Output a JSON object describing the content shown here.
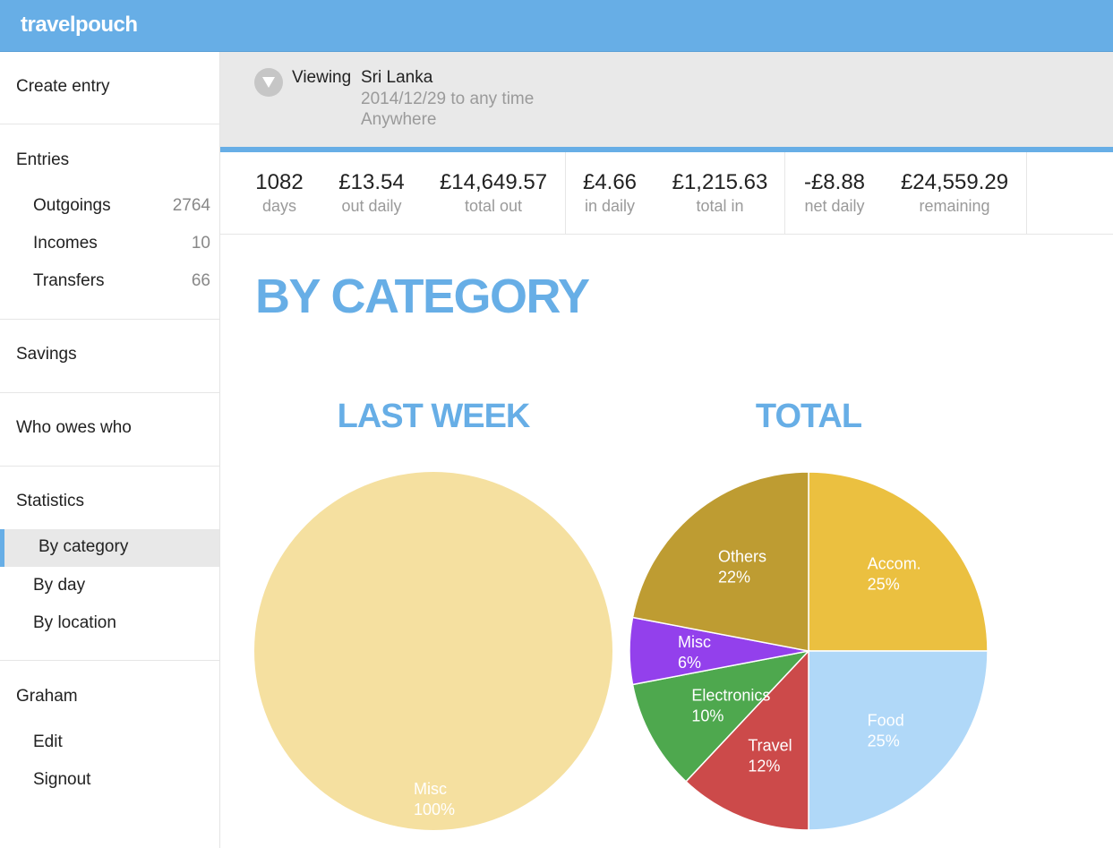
{
  "app": {
    "title": "travelpouch",
    "accent": "#67aee6"
  },
  "sidebar": {
    "create_entry": "Create entry",
    "entries_heading": "Entries",
    "entries": [
      {
        "label": "Outgoings",
        "count": "2764"
      },
      {
        "label": "Incomes",
        "count": "10"
      },
      {
        "label": "Transfers",
        "count": "66"
      }
    ],
    "savings": "Savings",
    "who_owes": "Who owes who",
    "statistics_heading": "Statistics",
    "statistics": [
      {
        "label": "By category",
        "active": true
      },
      {
        "label": "By day"
      },
      {
        "label": "By location"
      }
    ],
    "user_heading": "Graham",
    "user_items": [
      {
        "label": "Edit"
      },
      {
        "label": "Signout"
      }
    ]
  },
  "viewing": {
    "label": "Viewing",
    "place": "Sri Lanka",
    "dates": "2014/12/29 to any time",
    "location": "Anywhere",
    "toggle_icon": "chevron-down-icon"
  },
  "stats": [
    {
      "value": "1082",
      "caption": "days"
    },
    {
      "value": "£13.54",
      "caption": "out daily"
    },
    {
      "value": "£14,649.57",
      "caption": "total out"
    },
    {
      "value": "£4.66",
      "caption": "in daily"
    },
    {
      "value": "£1,215.63",
      "caption": "total in"
    },
    {
      "value": "-£8.88",
      "caption": "net daily"
    },
    {
      "value": "£24,559.29",
      "caption": "remaining"
    }
  ],
  "main": {
    "heading": "BY CATEGORY"
  },
  "chart_data": [
    {
      "type": "pie",
      "title": "LAST WEEK",
      "slices": [
        {
          "label": "Misc",
          "percent_label": "100%",
          "value": 100,
          "color": "#f5e0a0"
        }
      ]
    },
    {
      "type": "pie",
      "title": "TOTAL",
      "slices": [
        {
          "label": "Accom.",
          "percent_label": "25%",
          "value": 25,
          "color": "#ebc040"
        },
        {
          "label": "Food",
          "percent_label": "25%",
          "value": 25,
          "color": "#b0d8f8"
        },
        {
          "label": "Travel",
          "percent_label": "12%",
          "value": 12,
          "color": "#cc4a4a"
        },
        {
          "label": "Electronics",
          "percent_label": "10%",
          "value": 10,
          "color": "#4ea84e"
        },
        {
          "label": "Misc",
          "percent_label": "6%",
          "value": 6,
          "color": "#9340ec"
        },
        {
          "label": "Others",
          "percent_label": "22%",
          "value": 22,
          "color": "#be9c32"
        }
      ]
    }
  ]
}
